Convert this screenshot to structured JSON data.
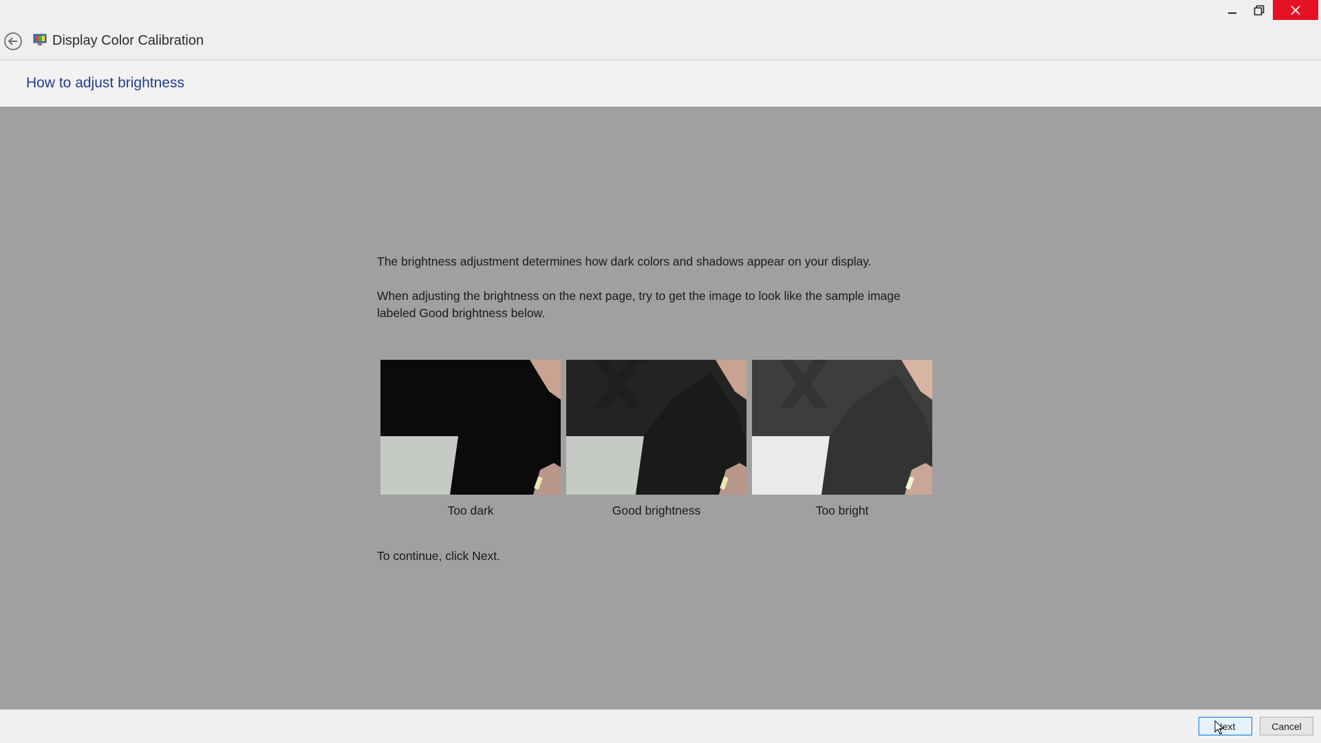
{
  "window": {
    "title": "Display Color Calibration",
    "controls": {
      "minimize_icon": "minimize-icon",
      "restore_icon": "restore-icon",
      "close_icon": "close-icon"
    }
  },
  "header": {
    "heading": "How to adjust brightness"
  },
  "content": {
    "paragraph_1": "The brightness adjustment determines how dark colors and shadows appear on your display.",
    "paragraph_2": "When adjusting the brightness on the next page, try to get the image to look like the sample image labeled Good brightness below.",
    "paragraph_3": "To continue, click Next.",
    "samples": [
      {
        "caption": "Too dark"
      },
      {
        "caption": "Good brightness"
      },
      {
        "caption": "Too bright"
      }
    ]
  },
  "buttons": {
    "next": "Next",
    "cancel": "Cancel"
  },
  "colors": {
    "background": "#a0a0a0",
    "heading": "#1f3d8c",
    "close_button": "#e81123"
  }
}
